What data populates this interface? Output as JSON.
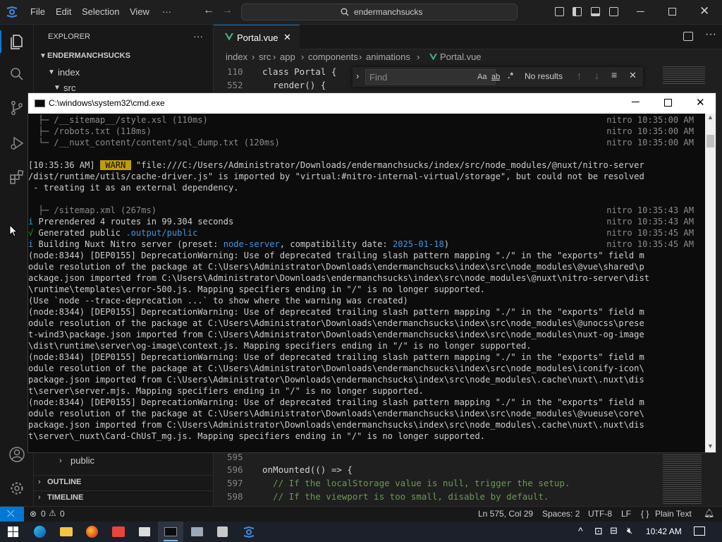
{
  "titlebar": {
    "menu": [
      "File",
      "Edit",
      "Selection",
      "View",
      "···"
    ],
    "search_text": "endermanchsucks"
  },
  "sidebar": {
    "title": "EXPLORER",
    "more": "···",
    "root": "ENDERMANCHSUCKS",
    "folder_index": "index",
    "folder_src": "src",
    "folder_public": "public",
    "outline": "OUTLINE",
    "timeline": "TIMELINE"
  },
  "editor": {
    "tab_label": "Portal.vue",
    "breadcrumb": [
      "index",
      "src",
      "app",
      "components",
      "animations",
      "Portal.vue"
    ],
    "lines_top": [
      {
        "num": "110",
        "code": "class Portal {"
      },
      {
        "num": "552",
        "code": "  render() {"
      }
    ],
    "lines_bottom": [
      {
        "num": "595",
        "code": ""
      },
      {
        "num": "596",
        "code": "onMounted(() => {"
      },
      {
        "num": "597",
        "code": "  // If the localStorage value is null, trigger the setup."
      },
      {
        "num": "598",
        "code": "  // If the viewport is too small, disable by default."
      }
    ],
    "find": {
      "placeholder": "Find",
      "aa": "Aa",
      "ab": "ab",
      "regex": ".*",
      "result": "No results"
    }
  },
  "statusbar": {
    "errors": "0",
    "warnings": "0",
    "position": "Ln 575, Col 29",
    "spaces": "Spaces: 2",
    "encoding": "UTF-8",
    "eol": "LF",
    "language_icon": "{ }",
    "language": "Plain Text"
  },
  "taskbar": {
    "time": "10:42 AM"
  },
  "cmd": {
    "title": "C:\\windows\\system32\\cmd.exe",
    "lines": [
      {
        "left": "  ├─ /__sitemap__/style.xsl (110ms)",
        "right": "nitro 10:35:00 AM",
        "cls": "grey"
      },
      {
        "left": "  ├─ /robots.txt (118ms)",
        "right": "nitro 10:35:00 AM",
        "cls": "grey"
      },
      {
        "left": "  └─ /__nuxt_content/content/sql_dump.txt (120ms)",
        "right": "nitro 10:35:00 AM",
        "cls": "grey"
      },
      {
        "left": "",
        "right": "",
        "cls": ""
      },
      {
        "left": "[10:35:36 AM] ",
        "warn": " WARN ",
        "rest": " \"file:///C:/Users/Administrator/Downloads/endermanchsucks/index/src/node_modules/@nuxt/nitro-server",
        "right": "",
        "cls": ""
      },
      {
        "left": "/dist/runtime/utils/cache-driver.js\" is imported by \"virtual:#nitro-internal-virtual/storage\", but could not be resolved",
        "right": "",
        "cls": ""
      },
      {
        "left": " - treating it as an external dependency.",
        "right": "",
        "cls": ""
      },
      {
        "left": "",
        "right": "",
        "cls": ""
      },
      {
        "left": "  ├─ /sitemap.xml (267ms)",
        "right": "nitro 10:35:43 AM",
        "cls": "grey"
      },
      {
        "left": "i Prerendered 4 routes in 99.304 seconds",
        "right": "nitro 10:35:43 AM",
        "cls": "info"
      },
      {
        "left": "√ Generated public ",
        "hl": ".output/public",
        "right": "nitro 10:35:45 AM",
        "cls": "ok"
      },
      {
        "left": "i Building Nuxt Nitro server (preset: ",
        "hl": "node-server",
        "mid": ", compatibility date: ",
        "hl2": "2025-01-18",
        "tail": ")",
        "right": "nitro 10:35:45 AM",
        "cls": "info"
      },
      {
        "left": "(node:8344) [DEP0155] DeprecationWarning: Use of deprecated trailing slash pattern mapping \"./\" in the \"exports\" field m",
        "right": "",
        "cls": ""
      },
      {
        "left": "odule resolution of the package at C:\\Users\\Administrator\\Downloads\\endermanchsucks\\index\\src\\node_modules\\@vue\\shared\\p",
        "right": "",
        "cls": ""
      },
      {
        "left": "ackage.json imported from C:\\Users\\Administrator\\Downloads\\endermanchsucks\\index\\src\\node_modules\\@nuxt\\nitro-server\\dist",
        "right": "",
        "cls": ""
      },
      {
        "left": "\\runtime\\templates\\error-500.js. Mapping specifiers ending in \"/\" is no longer supported.",
        "right": "",
        "cls": ""
      },
      {
        "left": "(Use `node --trace-deprecation ...` to show where the warning was created)",
        "right": "",
        "cls": ""
      },
      {
        "left": "(node:8344) [DEP0155] DeprecationWarning: Use of deprecated trailing slash pattern mapping \"./\" in the \"exports\" field m",
        "right": "",
        "cls": ""
      },
      {
        "left": "odule resolution of the package at C:\\Users\\Administrator\\Downloads\\endermanchsucks\\index\\src\\node_modules\\@unocss\\prese",
        "right": "",
        "cls": ""
      },
      {
        "left": "t-wind3\\package.json imported from C:\\Users\\Administrator\\Downloads\\endermanchsucks\\index\\src\\node_modules\\nuxt-og-image",
        "right": "",
        "cls": ""
      },
      {
        "left": "\\dist\\runtime\\server\\og-image\\context.js. Mapping specifiers ending in \"/\" is no longer supported.",
        "right": "",
        "cls": ""
      },
      {
        "left": "(node:8344) [DEP0155] DeprecationWarning: Use of deprecated trailing slash pattern mapping \"./\" in the \"exports\" field m",
        "right": "",
        "cls": ""
      },
      {
        "left": "odule resolution of the package at C:\\Users\\Administrator\\Downloads\\endermanchsucks\\index\\src\\node_modules\\iconify-icon\\",
        "right": "",
        "cls": ""
      },
      {
        "left": "package.json imported from C:\\Users\\Administrator\\Downloads\\endermanchsucks\\index\\src\\node_modules\\.cache\\nuxt\\.nuxt\\dis",
        "right": "",
        "cls": ""
      },
      {
        "left": "t\\server\\server.mjs. Mapping specifiers ending in \"/\" is no longer supported.",
        "right": "",
        "cls": ""
      },
      {
        "left": "(node:8344) [DEP0155] DeprecationWarning: Use of deprecated trailing slash pattern mapping \"./\" in the \"exports\" field m",
        "right": "",
        "cls": ""
      },
      {
        "left": "odule resolution of the package at C:\\Users\\Administrator\\Downloads\\endermanchsucks\\index\\src\\node_modules\\@vueuse\\core\\",
        "right": "",
        "cls": ""
      },
      {
        "left": "package.json imported from C:\\Users\\Administrator\\Downloads\\endermanchsucks\\index\\src\\node_modules\\.cache\\nuxt\\.nuxt\\dis",
        "right": "",
        "cls": ""
      },
      {
        "left": "t\\server\\_nuxt\\Card-ChUsT_mg.js. Mapping specifiers ending in \"/\" is no longer supported.",
        "right": "",
        "cls": ""
      }
    ]
  },
  "colors": {
    "accent": "#0078d4",
    "warn_bg": "#c19c00",
    "cyan": "#3a96dd",
    "green": "#13a10e",
    "vue_green": "#41b883"
  }
}
